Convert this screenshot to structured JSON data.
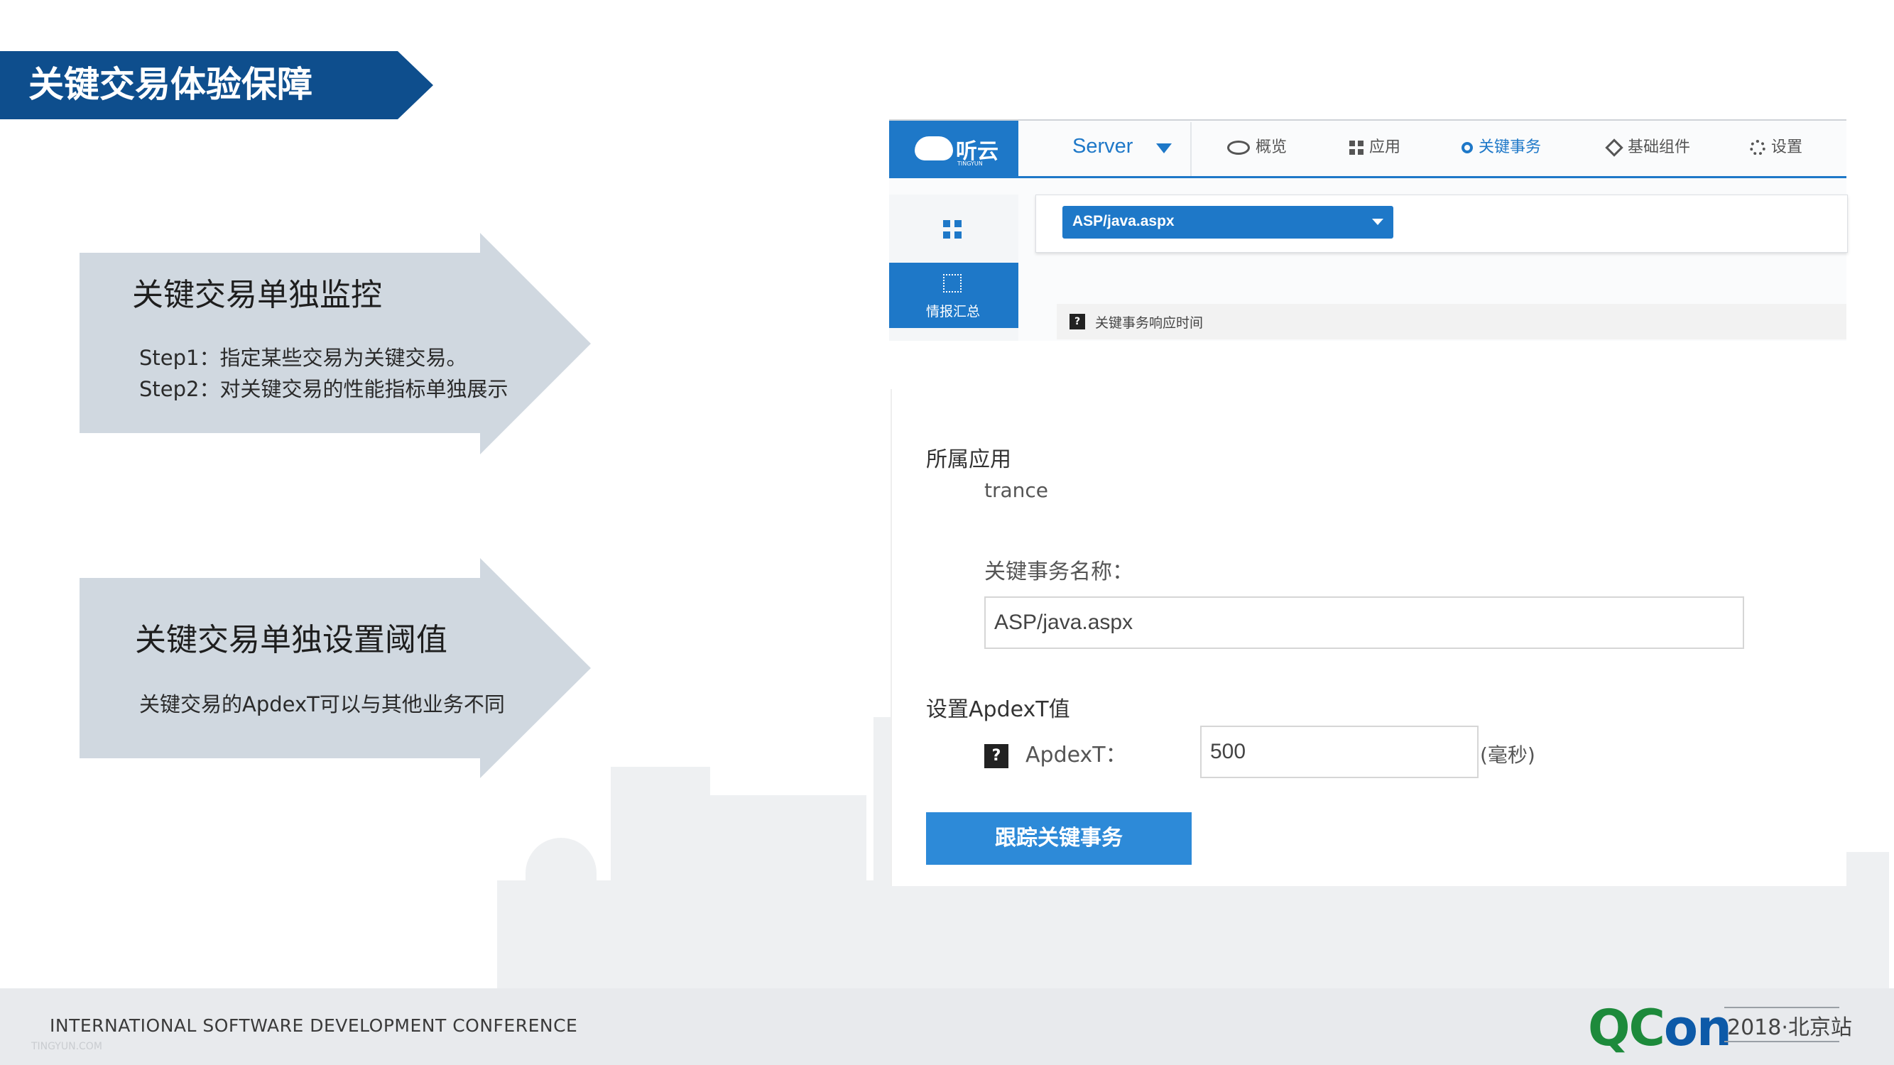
{
  "slide": {
    "title": "关键交易体验保障"
  },
  "panels": [
    {
      "title": "关键交易单独监控",
      "lines": [
        "Step1：指定某些交易为关键交易。",
        "Step2：对关键交易的性能指标单独展示"
      ]
    },
    {
      "title": "关键交易单独设置阈值",
      "lines": [
        "关键交易的ApdexT可以与其他业务不同"
      ]
    }
  ],
  "app": {
    "logo_text": "听云",
    "logo_subtext": "TINGYUN",
    "server_dropdown": "Server",
    "nav": [
      {
        "label": "概览",
        "icon": "eye-icon"
      },
      {
        "label": "应用",
        "icon": "grid-icon"
      },
      {
        "label": "关键事务",
        "icon": "target-icon"
      },
      {
        "label": "基础组件",
        "icon": "cube-icon"
      },
      {
        "label": "设置",
        "icon": "gear-icon"
      }
    ],
    "side": {
      "active_label": "情报汇总"
    },
    "transaction_select": "ASP/java.aspx",
    "row_label": "关键事务响应时间",
    "colors": {
      "primary": "#1e78c8",
      "button": "#2d8ad8",
      "banner": "#0e4e8d"
    }
  },
  "form": {
    "app_label": "所属应用",
    "app_value": "trance",
    "name_label": "关键事务名称：",
    "name_value": "ASP/java.aspx",
    "apdex_section": "设置ApdexT值",
    "apdex_label": "ApdexT：",
    "apdex_value": "500",
    "apdex_unit": "(毫秒)",
    "submit": "跟踪关键事务"
  },
  "footer": {
    "conference": "INTERNATIONAL SOFTWARE DEVELOPMENT CONFERENCE",
    "small": "TINGYUN.COM",
    "logo_q": "QC",
    "logo_on": "on",
    "edition": "2018·北京站"
  }
}
